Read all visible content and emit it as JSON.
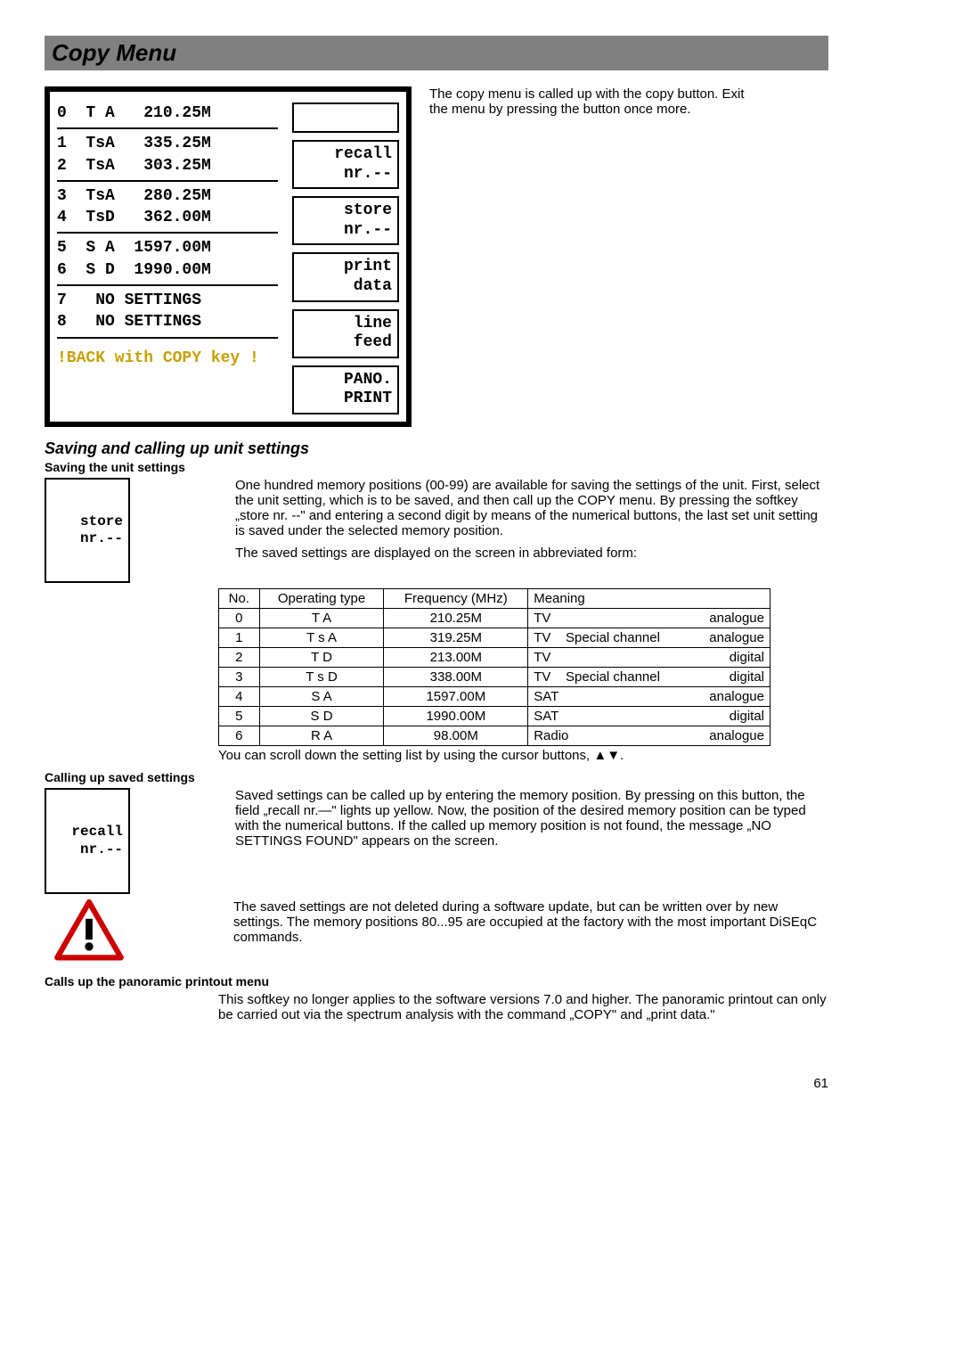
{
  "page": {
    "number": "61"
  },
  "title": "Copy Menu",
  "screen": {
    "rows": [
      "0  T A   210.25M ",
      "1  TsA   335.25M ",
      "2  TsA   303.25M ",
      "3  TsA   280.25M ",
      "4  TsD   362.00M ",
      "5  S A  1597.00M ",
      "6  S D  1990.00M ",
      "7   NO SETTINGS ",
      "8   NO SETTINGS "
    ],
    "back": "!BACK with COPY key !",
    "softkeys": {
      "recall": "recall\nnr.--",
      "store": "store\nnr.--",
      "print": "print\ndata",
      "line": "line\nfeed",
      "pano": "PANO.\nPRINT"
    }
  },
  "side_note": "The copy menu is called up with the copy button. Exit the menu by pressing the button once more.",
  "section1": {
    "heading": "Saving and calling up unit settings",
    "sub1": "Saving the unit settings",
    "storebox": "store\nnr.--",
    "p1": "One hundred memory positions (00-99) are available for saving the settings of the unit. First, select the unit setting, which is to be saved, and then call up the COPY menu. By pressing the softkey „store nr. --\" and entering a second digit by means of the numerical buttons, the last set unit setting is saved under the selected memory position.",
    "p2": "The saved settings are displayed on the screen in abbreviated form:",
    "table": {
      "headers": [
        "No.",
        "Operating type",
        "Frequency (MHz)",
        "Meaning"
      ],
      "rows": [
        {
          "no": "0",
          "op": "T A",
          "freq": "210.25M",
          "m_left": "TV",
          "m_mid": "",
          "m_right": "analogue"
        },
        {
          "no": "1",
          "op": "T s A",
          "freq": "319.25M",
          "m_left": "TV",
          "m_mid": "Special channel",
          "m_right": "analogue"
        },
        {
          "no": "2",
          "op": "T D",
          "freq": "213.00M",
          "m_left": "TV",
          "m_mid": "",
          "m_right": "digital"
        },
        {
          "no": "3",
          "op": "T s D",
          "freq": "338.00M",
          "m_left": "TV",
          "m_mid": "Special channel",
          "m_right": "digital"
        },
        {
          "no": "4",
          "op": "S A",
          "freq": "1597.00M",
          "m_left": "SAT",
          "m_mid": "",
          "m_right": "analogue"
        },
        {
          "no": "5",
          "op": "S D",
          "freq": "1990.00M",
          "m_left": "SAT",
          "m_mid": "",
          "m_right": "digital"
        },
        {
          "no": "6",
          "op": "R A",
          "freq": "98.00M",
          "m_left": "Radio",
          "m_mid": "",
          "m_right": "analogue"
        }
      ]
    },
    "scroll_note": "You can scroll down the setting list by using the cursor buttons, ▲▼."
  },
  "section2": {
    "sub": "Calling up saved settings",
    "recallbox": "recall\nnr.--",
    "p1": "Saved settings can be called up by entering the memory position.  By pressing on this button, the field „recall nr.—\" lights up yellow. Now, the position of the desired memory position can be typed with the numerical buttons. If the called up memory position is not found, the message  „NO SETTINGS FOUND\" appears on the screen.",
    "p2": "The saved settings are not deleted during a software update, but can be written over by new settings. The memory positions 80...95 are occupied at the factory with the most important DiSEqC commands."
  },
  "section3": {
    "sub": "Calls up the panoramic printout menu",
    "p1": "This softkey no longer applies to the software versions 7.0 and higher. The panoramic printout can only be carried out via the spectrum analysis with the command „COPY\" and „print data.\""
  }
}
